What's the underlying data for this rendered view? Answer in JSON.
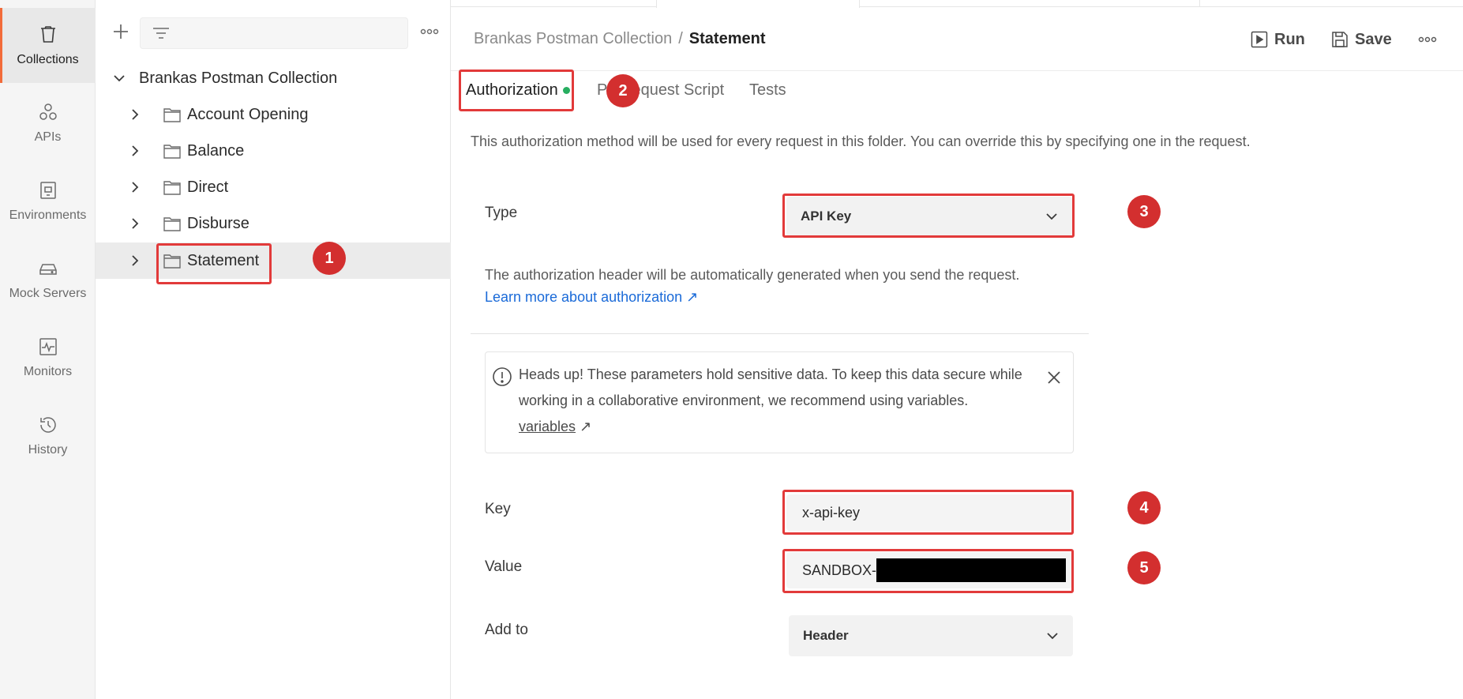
{
  "rail": {
    "items": [
      {
        "label": "Collections",
        "icon": "trash-can-icon"
      },
      {
        "label": "APIs",
        "icon": "apis-icon"
      },
      {
        "label": "Environments",
        "icon": "environment-icon"
      },
      {
        "label": "Mock Servers",
        "icon": "mock-server-icon"
      },
      {
        "label": "Monitors",
        "icon": "monitor-icon"
      },
      {
        "label": "History",
        "icon": "history-icon"
      }
    ]
  },
  "tree": {
    "collection_name": "Brankas Postman Collection",
    "folders": [
      "Account Opening",
      "Balance",
      "Direct",
      "Disburse",
      "Statement"
    ],
    "selected": "Statement"
  },
  "header": {
    "breadcrumb_parent": "Brankas Postman Collection",
    "breadcrumb_sep": "/",
    "breadcrumb_current": "Statement",
    "run_label": "Run",
    "save_label": "Save"
  },
  "tabs": {
    "authorization": "Authorization",
    "prerequest": "Pre-request Script",
    "tests": "Tests"
  },
  "auth": {
    "description": "This authorization method will be used for every request in this folder. You can override this by specifying one in the request.",
    "type_label": "Type",
    "type_value": "API Key",
    "note": "The authorization header will be automatically generated when you send the request.",
    "learn_more": "Learn more about authorization ↗",
    "alert_text": "Heads up! These parameters hold sensitive data. To keep this data secure while working in a collaborative environment, we recommend using variables.",
    "alert_link": "variables",
    "alert_link_arrow": "↗",
    "key_label": "Key",
    "key_value": "x-api-key",
    "value_label": "Value",
    "value_prefix": "SANDBOX-",
    "add_to_label": "Add to",
    "add_to_value": "Header"
  },
  "annotations": [
    "1",
    "2",
    "3",
    "4",
    "5"
  ],
  "colors": {
    "highlight": "#e23a3a",
    "marker": "#d32f2f",
    "link": "#1a6ad8",
    "active_rail": "#f26b3a",
    "status_dot": "#27ae60"
  }
}
